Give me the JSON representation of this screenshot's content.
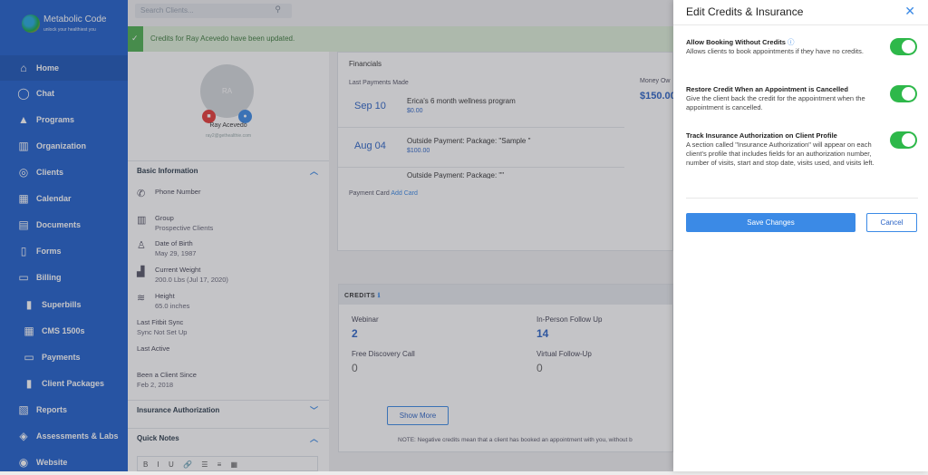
{
  "brand": {
    "name": "Metabolic Code",
    "tagline": "unlock your healthiest you"
  },
  "sidebar": {
    "items": [
      {
        "label": "Home",
        "icon": "home-icon",
        "glyph": "⌂"
      },
      {
        "label": "Chat",
        "icon": "chat-icon",
        "glyph": "◯"
      },
      {
        "label": "Programs",
        "icon": "graduation-cap-icon",
        "glyph": "▲"
      },
      {
        "label": "Organization",
        "icon": "building-icon",
        "glyph": "▥"
      },
      {
        "label": "Clients",
        "icon": "clients-icon",
        "glyph": "◎"
      },
      {
        "label": "Calendar",
        "icon": "calendar-icon",
        "glyph": "▦"
      },
      {
        "label": "Documents",
        "icon": "documents-icon",
        "glyph": "▤"
      },
      {
        "label": "Forms",
        "icon": "forms-icon",
        "glyph": "▯"
      },
      {
        "label": "Billing",
        "icon": "billing-icon",
        "glyph": "▭"
      },
      {
        "label": "Superbills",
        "icon": "superbills-icon",
        "glyph": "▮"
      },
      {
        "label": "CMS 1500s",
        "icon": "cms-icon",
        "glyph": "▦"
      },
      {
        "label": "Payments",
        "icon": "payments-icon",
        "glyph": "▭"
      },
      {
        "label": "Client Packages",
        "icon": "packages-icon",
        "glyph": "▮"
      },
      {
        "label": "Reports",
        "icon": "reports-icon",
        "glyph": "▧"
      },
      {
        "label": "Assessments & Labs",
        "icon": "assessments-icon",
        "glyph": "◈"
      },
      {
        "label": "Website",
        "icon": "website-icon",
        "glyph": "◉"
      }
    ]
  },
  "search": {
    "placeholder": "Search Clients..."
  },
  "banner": {
    "message": "Credits for Ray Acevedo have been updated."
  },
  "profile": {
    "initials": "RA",
    "name": "Ray Acevedo",
    "email": "ray2@gethealthie.com"
  },
  "basic_info": {
    "title": "Basic Information",
    "phone_label": "Phone Number",
    "group_label": "Group",
    "group_value": "Prospective Clients",
    "dob_label": "Date of Birth",
    "dob_value": "May 29, 1987",
    "weight_label": "Current Weight",
    "weight_value": "200.0 Lbs (Jul 17, 2020)",
    "height_label": "Height",
    "height_value": "65.0 inches",
    "fitbit_label": "Last Fitbit Sync",
    "fitbit_value": "Sync Not Set Up",
    "active_label": "Last Active",
    "since_label": "Been a Client Since",
    "since_value": "Feb 2, 2018"
  },
  "insurance": {
    "title": "Insurance Authorization"
  },
  "quick_notes": {
    "title": "Quick Notes",
    "toolbar": "B I U 🔗 ☰ ≡ ▦"
  },
  "financials": {
    "title": "Financials",
    "last_payments": "Last Payments Made",
    "money_owed_label": "Money Ow",
    "money_owed_value": "$150.00",
    "payments": [
      {
        "date": "Sep 10",
        "desc": "Erica's 6 month wellness program",
        "amount": "$0.00"
      },
      {
        "date": "Aug 04",
        "desc": "Outside Payment: Package: \"Sample \"",
        "amount": "$100.00"
      },
      {
        "date": "",
        "desc": "Outside Payment: Package: \"\"",
        "amount": ""
      }
    ],
    "payment_card": "Payment Card",
    "add_card": "Add Card"
  },
  "credits": {
    "title": "CREDITS",
    "info_glyph": "ℹ",
    "items": [
      {
        "name": "Webinar",
        "value": "2"
      },
      {
        "name": "In-Person Follow Up",
        "value": "14"
      },
      {
        "name": "Free Discovery Call",
        "value": "0"
      },
      {
        "name": "Virtual Follow-Up",
        "value": "0"
      }
    ],
    "show_more": "Show More",
    "note": "NOTE: Negative credits mean that a client has booked an appointment with you, without b"
  },
  "panel": {
    "title": "Edit Credits & Insurance",
    "options": [
      {
        "title": "Allow Booking Without Credits",
        "desc": "Allows clients to book appointments if they have no credits.",
        "enabled": true
      },
      {
        "title": "Restore Credit When an Appointment is Cancelled",
        "desc": "Give the client back the credit for the appointment when the appointment is cancelled.",
        "enabled": true
      },
      {
        "title": "Track Insurance Authorization on Client Profile",
        "desc": "A section called \"Insurance Authorization\" will appear on each client's profile that includes fields for an authorization number, number of visits, start and stop date, visits used, and visits left.",
        "enabled": true
      }
    ],
    "save": "Save Changes",
    "cancel": "Cancel"
  }
}
